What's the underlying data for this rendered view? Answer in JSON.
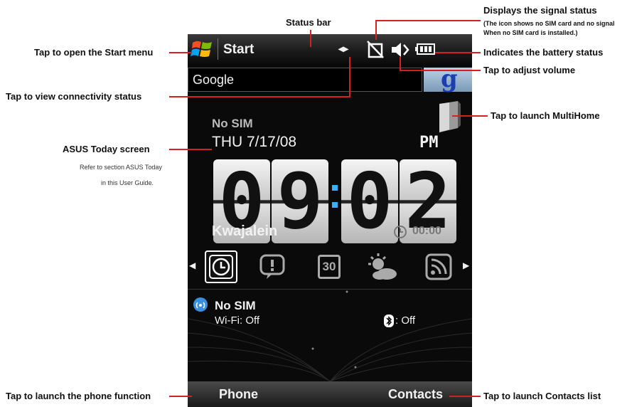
{
  "status_bar": {
    "start_label": "Start"
  },
  "search": {
    "value": "Google",
    "button": "g"
  },
  "today": {
    "sim": "No SIM",
    "date": "THU 7/17/08",
    "ampm": "PM",
    "hour": [
      "0",
      "9"
    ],
    "minute": [
      "0",
      "2"
    ],
    "city": "Kwajalein",
    "alarm": "00:00"
  },
  "shortcuts": [
    "clock-icon",
    "notification-icon",
    "calendar-icon",
    "weather-icon",
    "rss-icon"
  ],
  "calendar_day": "30",
  "connectivity": {
    "title": "No SIM",
    "wifi": "Wi-Fi: Off",
    "bt": ": Off"
  },
  "softkeys": {
    "left": "Phone",
    "right": "Contacts"
  },
  "callouts": {
    "status_bar": "Status bar",
    "signal": "Displays the signal status",
    "signal_note1": "(The icon shows no SIM card and no signal",
    "signal_note2": "When no SIM card is installed.)",
    "start": "Tap to open the Start menu",
    "battery": "Indicates the battery status",
    "volume": "Tap to adjust volume",
    "connectivity": "Tap to view connectivity status",
    "multihome": "Tap to launch MultiHome",
    "today": "ASUS Today screen",
    "today_note1": "Refer to section ASUS Today",
    "today_note2": "in this User Guide.",
    "phone": "Tap to launch the phone function",
    "contacts": "Tap to launch Contacts list"
  },
  "colors": {
    "callout_line": "#d32020",
    "accent_blue": "#3ab0ff"
  }
}
